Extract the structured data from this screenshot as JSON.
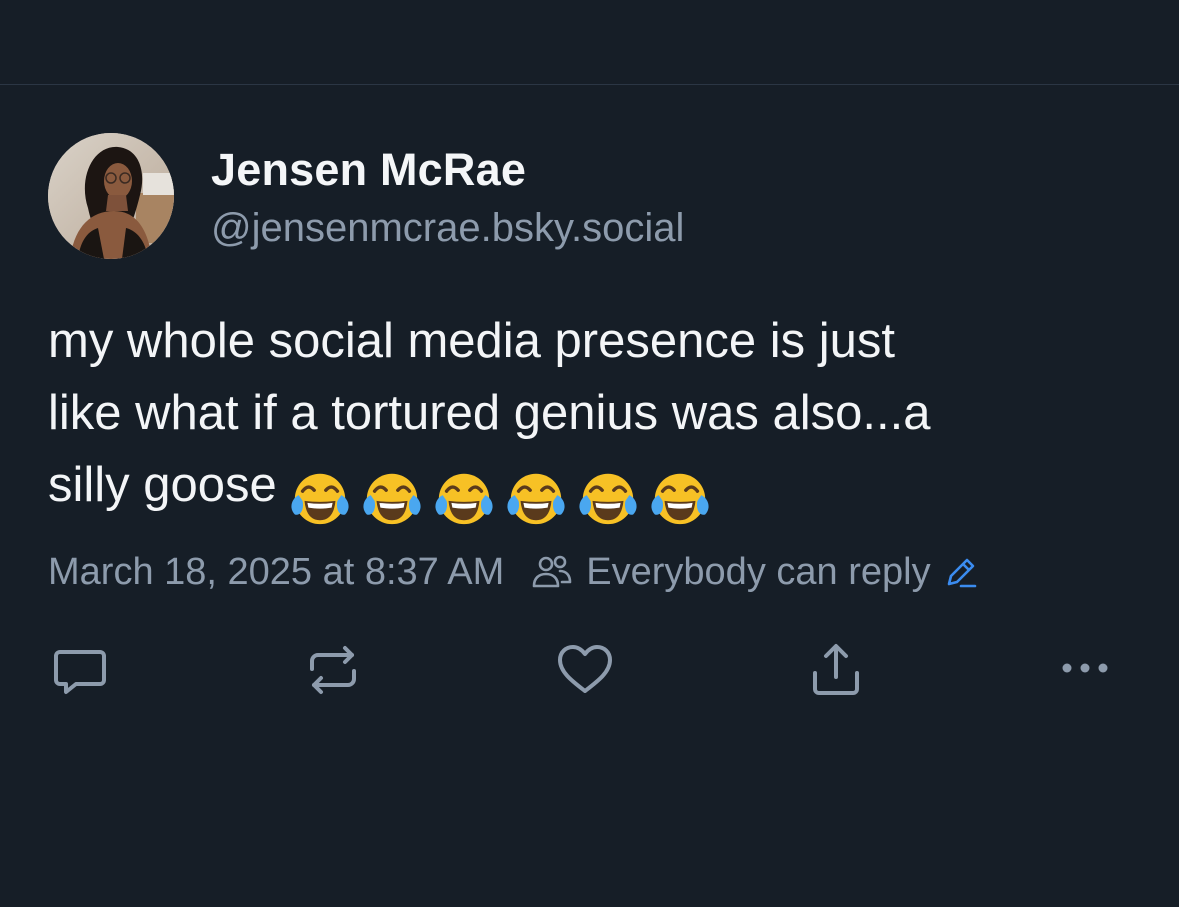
{
  "colors": {
    "background": "#161e27",
    "primary_text": "#f3f5f7",
    "secondary_text": "#8d9bac",
    "accent": "#3b8cf0",
    "icon": "#8d9bac",
    "divider": "#2b3644"
  },
  "post": {
    "author": {
      "display_name": "Jensen McRae",
      "handle": "@jensenmcrae.bsky.social",
      "avatar": "avatar-photo"
    },
    "text_lines": [
      "my whole social media presence is just",
      "like what if a tortured genius was also...a",
      "silly goose"
    ],
    "emojis": [
      "face-with-tears-of-joy",
      "face-with-tears-of-joy",
      "face-with-tears-of-joy",
      "face-with-tears-of-joy",
      "face-with-tears-of-joy",
      "face-with-tears-of-joy"
    ],
    "timestamp": "March 18, 2025 at 8:37 AM",
    "reply_setting": "Everybody can reply"
  },
  "actions": [
    {
      "name": "reply",
      "icon": "comment-icon"
    },
    {
      "name": "repost",
      "icon": "repost-icon"
    },
    {
      "name": "like",
      "icon": "heart-icon"
    },
    {
      "name": "share",
      "icon": "share-icon"
    },
    {
      "name": "more",
      "icon": "more-icon"
    }
  ]
}
